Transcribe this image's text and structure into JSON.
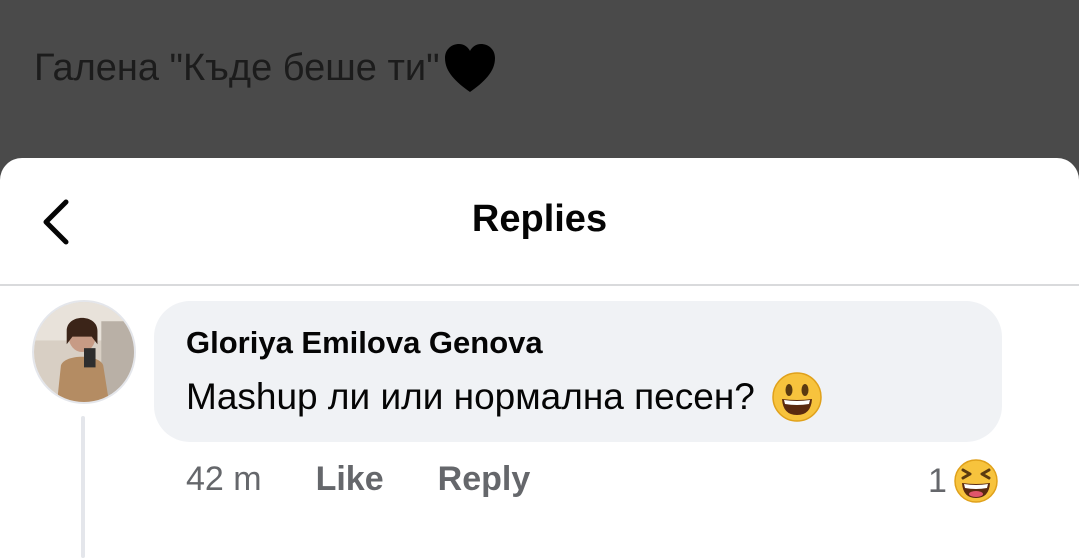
{
  "post": {
    "caption": "Галена \"Къде беше ти\"",
    "caption_icon": "black-heart-icon"
  },
  "sheet": {
    "title": "Replies",
    "back_icon": "chevron-left-icon"
  },
  "comment": {
    "author": "Gloriya Emilova Genova",
    "text": "Mashup ли или нормална песен?",
    "text_emoji": "grinning-face-icon",
    "timestamp": "42 m",
    "like_label": "Like",
    "reply_label": "Reply",
    "reaction_count": "1",
    "reaction_icon": "laughing-face-icon"
  },
  "colors": {
    "backdrop": "#4a4a4a",
    "sheet": "#ffffff",
    "bubble": "#f0f2f5",
    "secondary_text": "#65676b",
    "primary_text": "#050505"
  }
}
